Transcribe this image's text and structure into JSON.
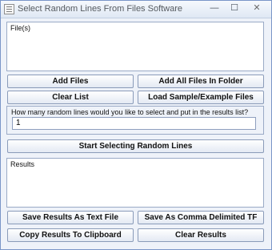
{
  "window": {
    "title": "Select Random Lines From Files Software",
    "min_glyph": "—",
    "max_glyph": "☐",
    "close_glyph": "✕"
  },
  "files_panel": {
    "label": "File(s)"
  },
  "file_buttons": {
    "add_files": "Add Files",
    "add_all_in_folder": "Add All Files In Folder",
    "clear_list": "Clear List",
    "load_sample": "Load Sample/Example Files"
  },
  "settings": {
    "question": "How many random lines would you like to select and put in the results list?",
    "line_count": "1"
  },
  "start_button": "Start Selecting Random Lines",
  "results_panel": {
    "label": "Results"
  },
  "result_buttons": {
    "save_text": "Save Results As Text File",
    "save_csv": "Save As Comma Delimited TF",
    "copy_clipboard": "Copy Results To Clipboard",
    "clear_results": "Clear Results"
  },
  "colors": {
    "window_bg": "#eef2f9",
    "border": "#7a96c8",
    "button_top": "#ffffff",
    "button_bottom": "#e3e9f3"
  }
}
